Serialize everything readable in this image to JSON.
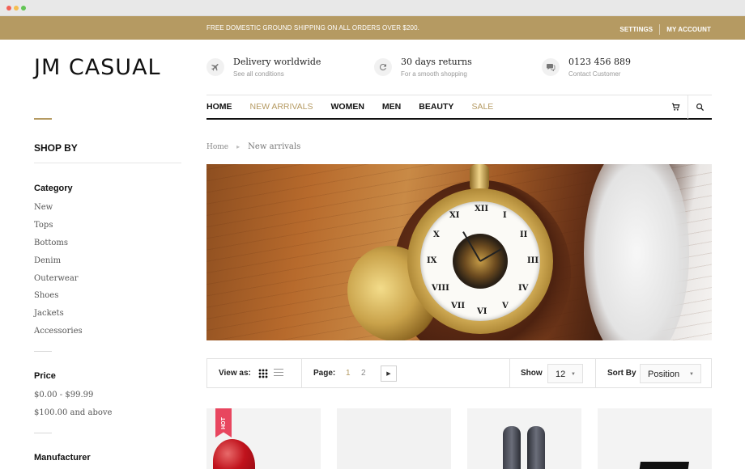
{
  "topbar": {
    "promo": "FREE DOMESTIC GROUND SHIPPING ON ALL ORDERS OVER $200.",
    "settings": "SETTINGS",
    "account": "MY ACCOUNT"
  },
  "logo": "JM CASUAL",
  "features": [
    {
      "icon": "plane-icon",
      "title": "Delivery worldwide",
      "subtitle": "See all conditions"
    },
    {
      "icon": "refresh-icon",
      "title": "30 days returns",
      "subtitle": "For a smooth shopping"
    },
    {
      "icon": "chat-icon",
      "title": "0123 456 889",
      "subtitle": "Contact Customer"
    }
  ],
  "nav": {
    "items": [
      "HOME",
      "NEW ARRIVALS",
      "WOMEN",
      "MEN",
      "BEAUTY",
      "SALE"
    ],
    "accent_color": "#b59a62"
  },
  "sidebar": {
    "heading": "SHOP BY",
    "category": {
      "heading": "Category",
      "items": [
        "New",
        "Tops",
        "Bottoms",
        "Denim",
        "Outerwear",
        "Shoes",
        "Jackets",
        "Accessories"
      ]
    },
    "price": {
      "heading": "Price",
      "items": [
        "$0.00 - $99.99",
        "$100.00 and above"
      ]
    },
    "manufacturer": {
      "heading": "Manufacturer"
    }
  },
  "breadcrumb": {
    "home": "Home",
    "current": "New arrivals"
  },
  "toolbar": {
    "view_label": "View as:",
    "page_label": "Page:",
    "pages": [
      "1",
      "2"
    ],
    "current_page": "1",
    "show_label": "Show",
    "show_value": "12",
    "sort_label": "Sort By",
    "sort_value": "Position"
  },
  "products": [
    {
      "badge": "HOT"
    },
    {
      "badge": ""
    },
    {
      "badge": ""
    },
    {
      "badge": ""
    }
  ]
}
